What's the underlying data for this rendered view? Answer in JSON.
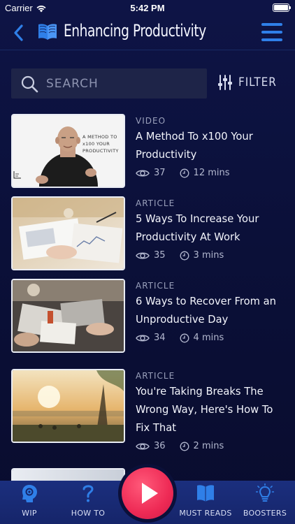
{
  "status": {
    "carrier": "Carrier",
    "time": "5:42 PM"
  },
  "nav": {
    "title": "Enhancing Productivity"
  },
  "search": {
    "placeholder": "SEARCH",
    "filter_label": "FILTER"
  },
  "items": [
    {
      "type": "VIDEO",
      "title": "A Method To x100 Your Productivity",
      "views": "37",
      "duration": "12 mins",
      "thumb_text": "A METHOD TO x100 YOUR PRODUCTIVITY"
    },
    {
      "type": "ARTICLE",
      "title": "5 Ways To Increase Your Productivity At Work",
      "views": "35",
      "duration": "3 mins"
    },
    {
      "type": "ARTICLE",
      "title": "6 Ways to Recover From an Unproductive Day",
      "views": "34",
      "duration": "4 mins"
    },
    {
      "type": "ARTICLE",
      "title": "You're Taking Breaks The Wrong Way, Here's How To Fix That",
      "views": "36",
      "duration": "2 mins"
    }
  ],
  "tabs": [
    {
      "label": "WIP"
    },
    {
      "label": "HOW TO"
    },
    {
      "label": "MUST READS"
    },
    {
      "label": "BOOSTERS"
    }
  ],
  "colors": {
    "accent": "#2f7fe8",
    "play": "#ee2a55",
    "background": "#0b1039",
    "tab_bar": "#1a2c78"
  }
}
